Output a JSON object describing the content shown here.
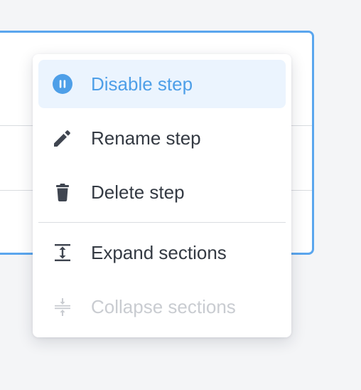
{
  "colors": {
    "accent": "#4e9fe8",
    "accent_bg": "#ebf4fe",
    "text": "#343a43",
    "disabled": "#c9ccd1",
    "card_border": "#5aa6ee"
  },
  "menu": {
    "items": [
      {
        "label": "Disable step",
        "icon": "pause-circle-icon",
        "state": "active"
      },
      {
        "label": "Rename step",
        "icon": "pencil-icon",
        "state": "normal"
      },
      {
        "label": "Delete step",
        "icon": "trash-icon",
        "state": "normal"
      },
      {
        "label": "Expand sections",
        "icon": "expand-vertical-icon",
        "state": "normal"
      },
      {
        "label": "Collapse sections",
        "icon": "collapse-vertical-icon",
        "state": "disabled"
      }
    ]
  }
}
